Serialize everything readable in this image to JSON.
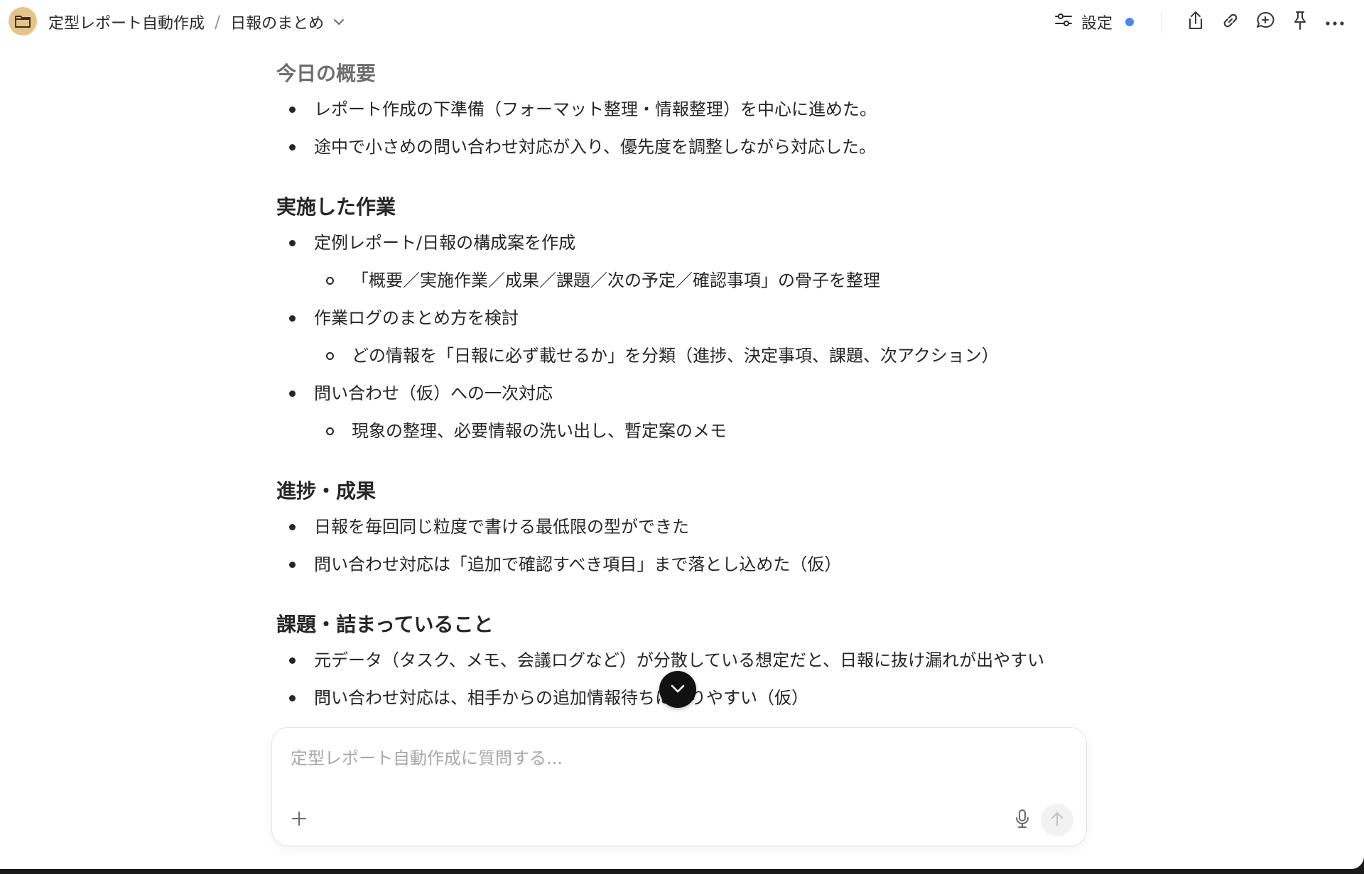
{
  "breadcrumb": {
    "project": "定型レポート自動作成",
    "separator": "/",
    "page": "日報のまとめ"
  },
  "toolbar": {
    "settings_label": "設定",
    "status_dot_color": "#4a86e8",
    "icons": [
      "share-icon",
      "link-icon",
      "comment-icon",
      "pin-icon",
      "more-icon"
    ]
  },
  "document": {
    "sections": [
      {
        "heading": "今日の概要",
        "items": [
          {
            "text": "レポート作成の下準備（フォーマット整理・情報整理）を中心に進めた。"
          },
          {
            "text": "途中で小さめの問い合わせ対応が入り、優先度を調整しながら対応した。"
          }
        ]
      },
      {
        "heading": "実施した作業",
        "items": [
          {
            "text": "定例レポート/日報の構成案を作成",
            "sub": "「概要／実施作業／成果／課題／次の予定／確認事項」の骨子を整理"
          },
          {
            "text": "作業ログのまとめ方を検討",
            "sub": "どの情報を「日報に必ず載せるか」を分類（進捗、決定事項、課題、次アクション）"
          },
          {
            "text": "問い合わせ（仮）への一次対応",
            "sub": "現象の整理、必要情報の洗い出し、暫定案のメモ"
          }
        ]
      },
      {
        "heading": "進捗・成果",
        "items": [
          {
            "text": "日報を毎回同じ粒度で書ける最低限の型ができた"
          },
          {
            "text": "問い合わせ対応は「追加で確認すべき項目」まで落とし込めた（仮）"
          }
        ]
      },
      {
        "heading": "課題・詰まっていること",
        "items": [
          {
            "text": "元データ（タスク、メモ、会議ログなど）が分散している想定だと、日報に抜け漏れが出やすい"
          },
          {
            "text": "問い合わせ対応は、相手からの追加情報待ちになりやすい（仮）"
          }
        ]
      }
    ]
  },
  "composer": {
    "placeholder": "定型レポート自動作成に質問する...",
    "value": ""
  },
  "colors": {
    "project_icon_bg": "#e5c487",
    "scroll_button_bg": "#111111"
  }
}
